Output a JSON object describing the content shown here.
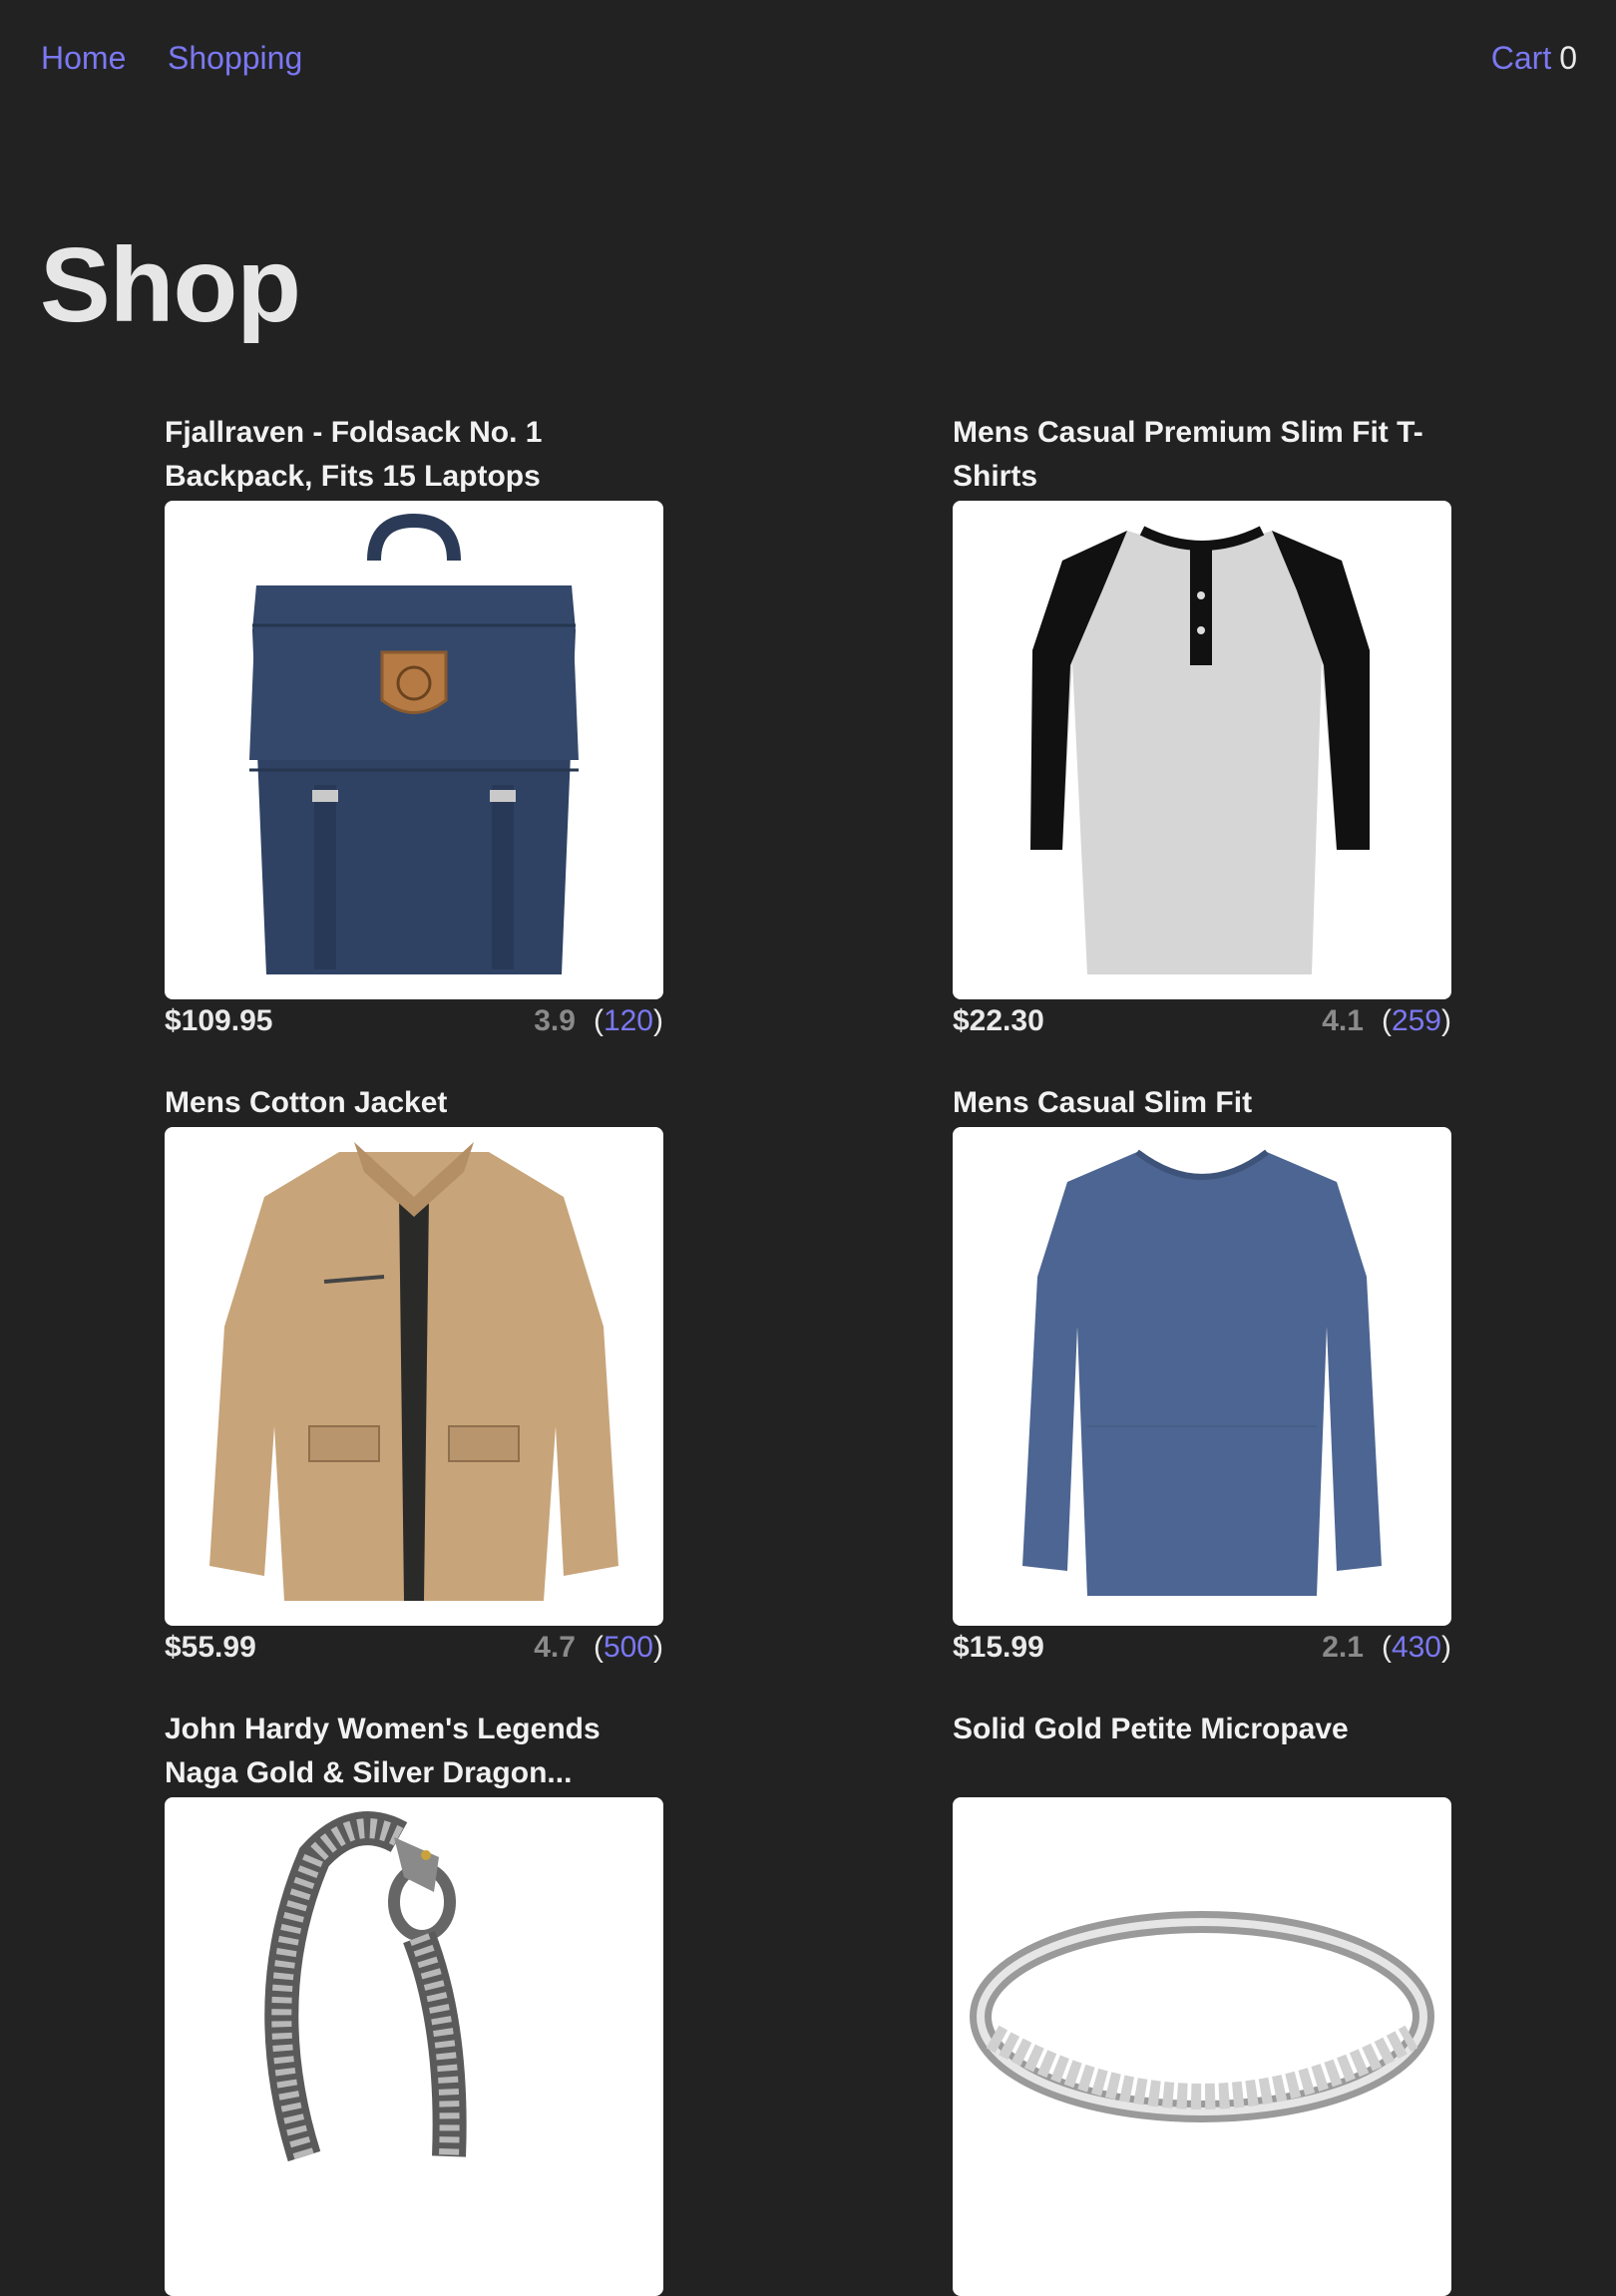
{
  "nav": {
    "home_label": "Home",
    "shopping_label": "Shopping",
    "cart_label": "Cart",
    "cart_count": "0"
  },
  "page": {
    "title": "Shop"
  },
  "colors": {
    "accent": "#7b78f2",
    "background": "#222223",
    "card_bg": "#ffffff"
  },
  "products": [
    {
      "title": "Fjallraven - Foldsack No. 1 Backpack, Fits 15 Laptops",
      "price": "$109.95",
      "rating": "3.9",
      "count": "120",
      "image": "backpack-image"
    },
    {
      "title": "Mens Casual Premium Slim Fit T-Shirts",
      "price": "$22.30",
      "rating": "4.1",
      "count": "259",
      "image": "raglan-tshirt-image"
    },
    {
      "title": "Mens Cotton Jacket",
      "price": "$55.99",
      "rating": "4.7",
      "count": "500",
      "image": "cotton-jacket-image"
    },
    {
      "title": "Mens Casual Slim Fit",
      "price": "$15.99",
      "rating": "2.1",
      "count": "430",
      "image": "longsleeve-tshirt-image"
    },
    {
      "title": "John Hardy Women's Legends Naga Gold & Silver Dragon...",
      "image": "dragon-bracelet-image"
    },
    {
      "title": "Solid Gold Petite Micropave",
      "image": "micropave-ring-image"
    }
  ]
}
